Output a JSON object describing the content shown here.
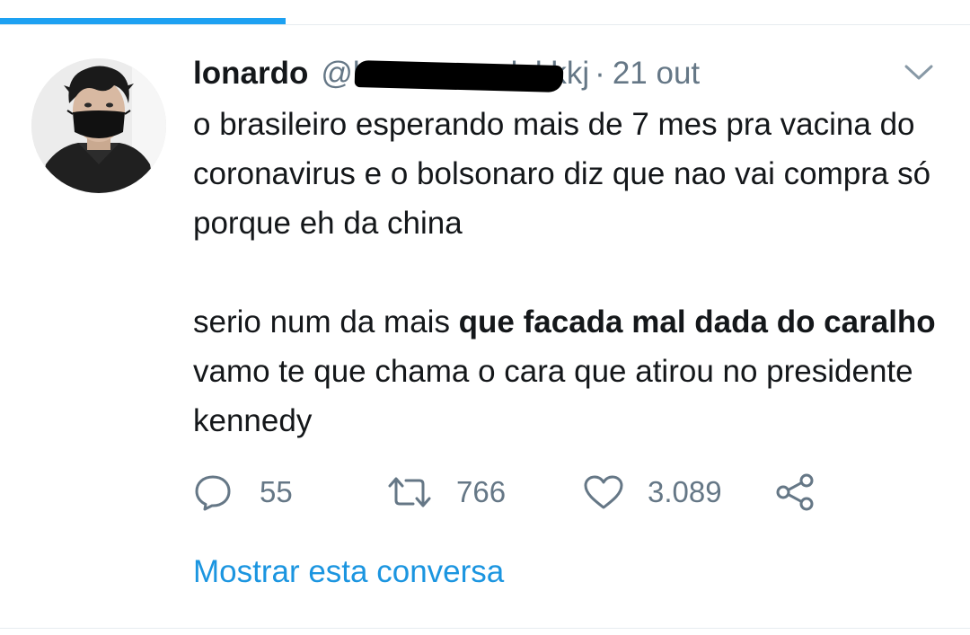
{
  "tweet": {
    "display_name": "lonardo",
    "handle_visible_prefix": "@l",
    "handle_visible_suffix": "lakkkj",
    "separator": "·",
    "timestamp": "21 out",
    "body_paragraph_1": "o brasileiro esperando mais de 7 mes pra vacina do coronavirus e o bolsonaro diz que nao vai compra só porque eh da china",
    "body_paragraph_2_before_bold": "serio num da mais ",
    "body_paragraph_2_bold": "que facada mal dada do caralho",
    "body_paragraph_2_after_bold": " vamo te que chama o cara que atirou no presidente kennedy"
  },
  "actions": {
    "reply_icon": "reply-bubble-icon",
    "reply_count": "55",
    "retweet_icon": "retweet-arrows-icon",
    "retweet_count": "766",
    "like_icon": "heart-icon",
    "like_count": "3.089",
    "share_icon": "share-nodes-icon"
  },
  "menu": {
    "caret_icon": "chevron-down-icon"
  },
  "show_thread_label": "Mostrar esta conversa",
  "colors": {
    "accent": "#1da1f2",
    "link": "#1b95e0",
    "secondary_text": "#657786",
    "primary_text": "#14171a",
    "redaction": "#000000"
  }
}
